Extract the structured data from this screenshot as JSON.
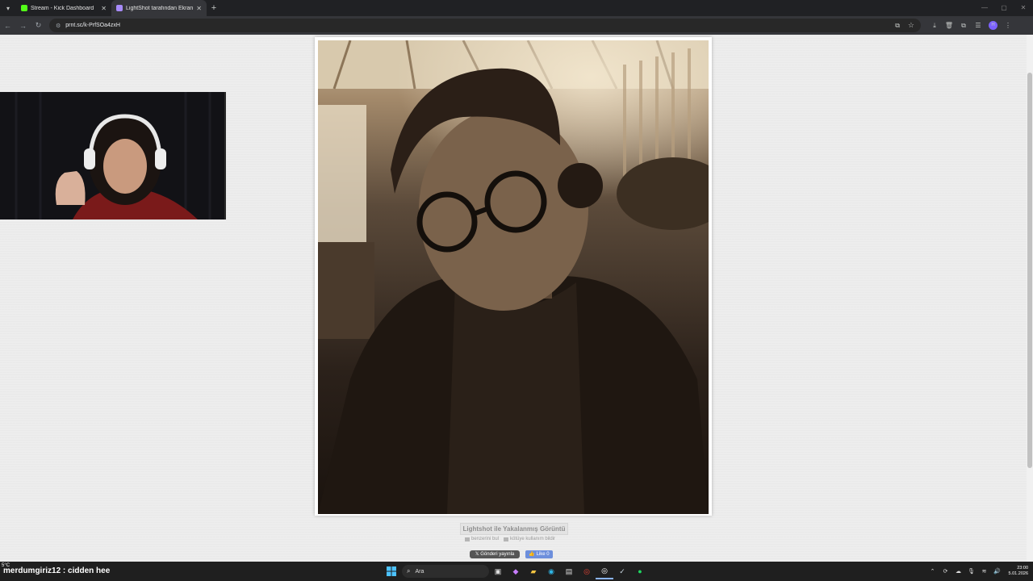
{
  "browser": {
    "tabs": [
      {
        "title": "Stream - Kick Dashboard",
        "favicon_color": "#53fc18",
        "active": false
      },
      {
        "title": "LightShot tarafından Ekran Gör",
        "favicon_color": "#a78bfa",
        "active": true
      }
    ],
    "new_tab": "+",
    "url": "prnt.sc/k-PrfSOa4zxH",
    "profile_initial": "H"
  },
  "page": {
    "caption": "Lightshot ile Yakalanmış Görüntü",
    "links": [
      {
        "label": "benzerini bul"
      },
      {
        "label": "kötüye kullanım bildir"
      }
    ],
    "share_x": "Gönderi yayınla",
    "share_fb": "Like 0"
  },
  "overlay": {
    "weather": "5°C",
    "chat_user": "merdumgiriz12",
    "chat_sep": " : ",
    "chat_message": "cidden hee"
  },
  "taskbar": {
    "search_placeholder": "Ara",
    "time": "23:00",
    "date": "5.01.2026"
  },
  "colors": {
    "taskbar_bg": "#1f1f1f",
    "page_bg": "#ededed",
    "kick_green": "#53fc18"
  }
}
